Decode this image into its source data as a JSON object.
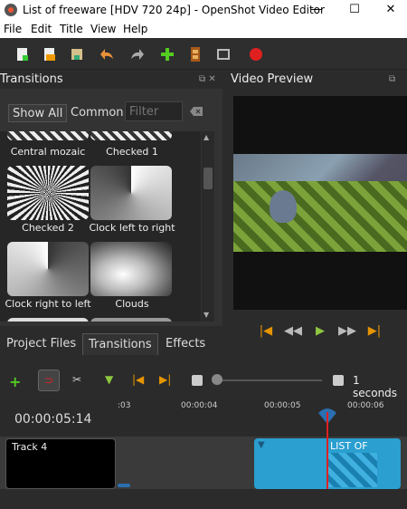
{
  "window": {
    "title": "List of freeware [HDV 720 24p] - OpenShot Video Editor",
    "minimize": "—",
    "maximize": "☐",
    "close": "✕"
  },
  "menu": [
    "File",
    "Edit",
    "Title",
    "View",
    "Help"
  ],
  "toolbar_icons": [
    "new-project-icon",
    "open-project-icon",
    "save-project-icon",
    "undo-icon",
    "redo-icon",
    "import-files-icon",
    "profile-icon",
    "full-screen-icon",
    "export-video-icon"
  ],
  "transitions": {
    "header": "Transitions",
    "filter_buttons": [
      "Show All",
      "Common"
    ],
    "filter_placeholder": "Filter",
    "items": [
      "Central mozaic",
      "Checked 1",
      "Checked 2",
      "Clock left to right",
      "Clock right to left",
      "Clouds"
    ]
  },
  "preview": {
    "header": "Video Preview"
  },
  "tabs": [
    "Project Files",
    "Transitions",
    "Effects"
  ],
  "timeline": {
    "timecode": "00:00:05:14",
    "ruler": [
      ":03",
      "00:00:04",
      "00:00:05",
      "00:00:06"
    ],
    "zoom_label": "1 seconds",
    "track": "Track 4",
    "clip": "LIST OF FREEW"
  }
}
